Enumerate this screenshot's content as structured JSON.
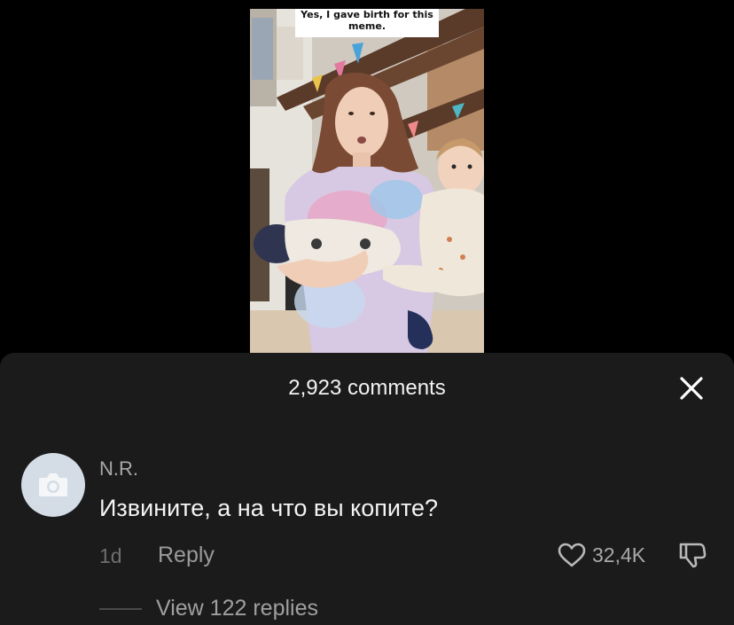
{
  "video": {
    "caption": "Yes, I gave birth for this meme."
  },
  "comments": {
    "title": "2,923 comments",
    "items": [
      {
        "username": "N.R.",
        "text": "Извините, а на что вы копите?",
        "time": "1d",
        "reply_label": "Reply",
        "likes": "32,4K",
        "view_replies": "View 122 replies"
      }
    ]
  },
  "icons": {
    "close": "close-icon",
    "avatar": "camera-icon",
    "like": "heart-icon",
    "dislike": "thumbs-down-icon"
  },
  "colors": {
    "sheet_bg": "#1b1b1b",
    "page_bg": "#000000",
    "avatar_bg": "#d4dde6"
  }
}
